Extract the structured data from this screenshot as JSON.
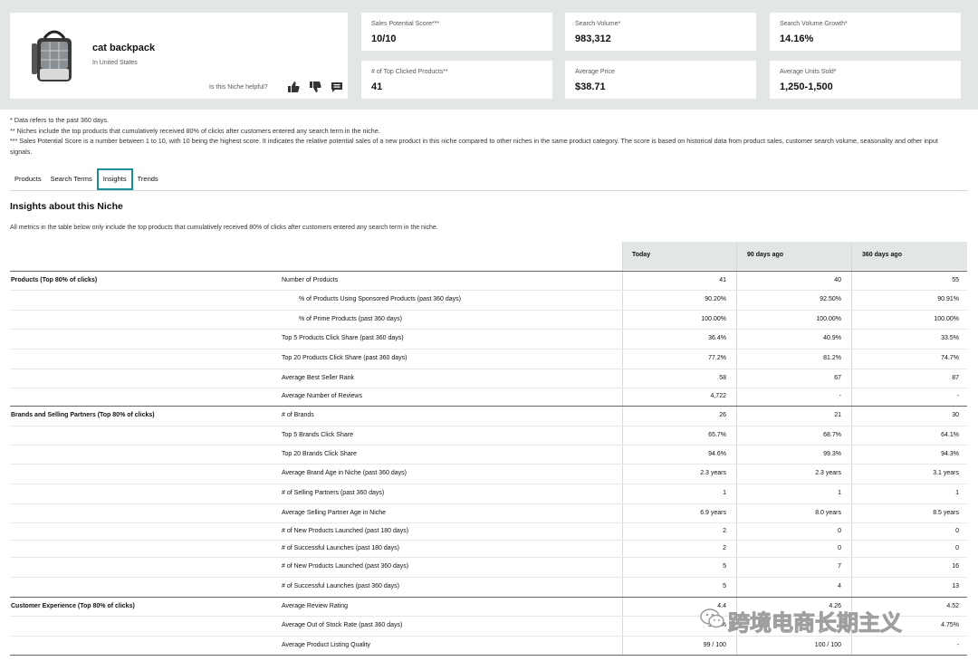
{
  "product": {
    "title": "cat backpack",
    "subtitle": "In United States",
    "helpful_prompt": "Is this Niche helpful?"
  },
  "metrics": [
    {
      "label": "Sales Potential Score***",
      "value": "10/10"
    },
    {
      "label": "Search Volume*",
      "value": "983,312"
    },
    {
      "label": "Search Volume Growth*",
      "value": "14.16%"
    },
    {
      "label": "# of Top Clicked Products**",
      "value": "41"
    },
    {
      "label": "Average Price",
      "value": "$38.71"
    },
    {
      "label": "Average Units Sold*",
      "value": "1,250-1,500"
    }
  ],
  "notes": [
    "* Data refers to the past 360 days.",
    "** Niches include the top products that cumulatively received 80% of clicks after customers entered any search term in the niche.",
    "*** Sales Potential Score is a number between 1 to 10, with 10 being the highest score. It indicates the relative potential sales of a new product in this niche compared to other niches in the same product category. The score is based on historical data from product sales, customer search volume, seasonality and other input signals."
  ],
  "tabs": [
    "Products",
    "Search Terms",
    "Insights",
    "Trends"
  ],
  "active_tab": "Insights",
  "section": {
    "title": "Insights about this Niche",
    "description": "All metrics in the table below only include the top products that cumulatively received 80% of clicks after customers entered any search term in the niche."
  },
  "table": {
    "headers": [
      "Today",
      "90 days ago",
      "360 days ago"
    ],
    "rows": [
      {
        "group": "Products (Top 80% of clicks)",
        "metric": "Number of Products",
        "indent": false,
        "values": [
          "41",
          "40",
          "55"
        ]
      },
      {
        "group": "",
        "metric": "% of Products Using Sponsored Products (past 360 days)",
        "indent": true,
        "values": [
          "90.20%",
          "92.50%",
          "90.91%"
        ]
      },
      {
        "group": "",
        "metric": "% of Prime Products (past 360 days)",
        "indent": true,
        "values": [
          "100.00%",
          "100.00%",
          "100.00%"
        ]
      },
      {
        "group": "",
        "metric": "Top 5 Products Click Share (past 360 days)",
        "indent": false,
        "values": [
          "36.4%",
          "40.9%",
          "33.5%"
        ]
      },
      {
        "group": "",
        "metric": "Top 20 Products Click Share (past 360 days)",
        "indent": false,
        "values": [
          "77.2%",
          "81.2%",
          "74.7%"
        ]
      },
      {
        "group": "",
        "metric": "Average Best Seller Rank",
        "indent": false,
        "values": [
          "58",
          "67",
          "87"
        ]
      },
      {
        "group": "",
        "metric": "Average Number of Reviews",
        "indent": false,
        "values": [
          "4,722",
          "-",
          "-"
        ]
      },
      {
        "group": "Brands and Selling Partners (Top 80% of clicks)",
        "metric": "# of Brands",
        "indent": false,
        "values": [
          "26",
          "21",
          "30"
        ]
      },
      {
        "group": "",
        "metric": "Top 5 Brands Click Share",
        "indent": false,
        "values": [
          "65.7%",
          "68.7%",
          "64.1%"
        ]
      },
      {
        "group": "",
        "metric": "Top 20 Brands Click Share",
        "indent": false,
        "values": [
          "94.6%",
          "99.3%",
          "94.3%"
        ]
      },
      {
        "group": "",
        "metric": "Average Brand Age in Niche (past 360 days)",
        "indent": false,
        "values": [
          "2.3 years",
          "2.3 years",
          "3.1 years"
        ]
      },
      {
        "group": "",
        "metric": "# of Selling Partners (past 360 days)",
        "indent": false,
        "values": [
          "1",
          "1",
          "1"
        ]
      },
      {
        "group": "",
        "metric": "Average Selling Partner Age in Niche",
        "indent": false,
        "values": [
          "6.9 years",
          "8.0 years",
          "8.5 years"
        ]
      },
      {
        "group": "",
        "metric": "# of New Products Launched (past 180 days)",
        "indent": false,
        "values": [
          "2",
          "0",
          "0"
        ]
      },
      {
        "group": "",
        "metric": "# of Successful Launches (past 180 days)",
        "indent": false,
        "values": [
          "2",
          "0",
          "0"
        ]
      },
      {
        "group": "",
        "metric": "# of New Products Launched (past 360 days)",
        "indent": false,
        "values": [
          "5",
          "7",
          "16"
        ]
      },
      {
        "group": "",
        "metric": "# of Successful Launches (past 360 days)",
        "indent": false,
        "values": [
          "5",
          "4",
          "13"
        ]
      },
      {
        "group": "Customer Experience (Top 80% of clicks)",
        "metric": "Average Review Rating",
        "indent": false,
        "values": [
          "4.4",
          "4.26",
          "4.52"
        ]
      },
      {
        "group": "",
        "metric": "Average Out of Stock Rate (past 360 days)",
        "indent": false,
        "values": [
          "3.62%",
          "",
          "4.75%"
        ]
      },
      {
        "group": "",
        "metric": "Average Product Listing Quality",
        "indent": false,
        "values": [
          "99 / 100",
          "100 / 100",
          "-"
        ]
      }
    ]
  },
  "watermark": {
    "text": "跨境电商长期主义",
    "icon": "wechat-icon"
  }
}
